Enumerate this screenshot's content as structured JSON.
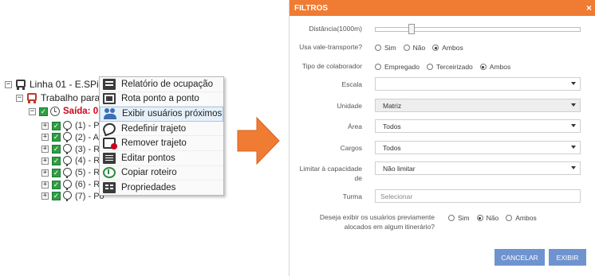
{
  "tree": {
    "line_label": "Linha 01 - E.SPinha",
    "route_label": "Trabalho para c",
    "saida_label": "Saída: 01:",
    "points": [
      "(1) - Po",
      "(2) - Av",
      "(3) - R.",
      "(4) - R.",
      "(5) - R.",
      "(6) - R.",
      "(7) - Po"
    ]
  },
  "context_menu": {
    "items": [
      {
        "label": "Relatório de ocupação",
        "icon": "report-icon"
      },
      {
        "label": "Rota ponto a ponto",
        "icon": "route-icon"
      },
      {
        "label": "Exibir usuários próximos",
        "icon": "users-icon"
      },
      {
        "label": "Redefinir trajeto",
        "icon": "redefine-route-icon"
      },
      {
        "label": "Remover trajeto",
        "icon": "remove-route-icon"
      },
      {
        "label": "Editar pontos",
        "icon": "edit-points-icon"
      },
      {
        "label": "Copiar roteiro",
        "icon": "copy-route-icon"
      },
      {
        "label": "Propriedades",
        "icon": "properties-icon"
      }
    ],
    "active_index": 2
  },
  "modal": {
    "title": "FILTROS",
    "close_symbol": "×",
    "distance_label": "Distância(1000m)",
    "vale_label": "Usa vale-transporte?",
    "vale_options": [
      "Sim",
      "Não",
      "Ambos"
    ],
    "vale_selected": "Ambos",
    "tipo_label": "Tipo de colaborador",
    "tipo_options": [
      "Empregado",
      "Terceirizado",
      "Ambos"
    ],
    "tipo_selected": "Ambos",
    "escala_label": "Escala",
    "escala_value": "",
    "unidade_label": "Unidade",
    "unidade_value": "Matriz",
    "area_label": "Área",
    "area_value": "Todos",
    "cargos_label": "Cargos",
    "cargos_value": "Todos",
    "limitar_label_1": "Limitar à capacidade",
    "limitar_label_2": "de",
    "limitar_value": "Não limitar",
    "turma_label": "Turma",
    "turma_placeholder": "Selecionar",
    "prev_label_1": "Deseja exibir os usuários previamente",
    "prev_label_2": "alocados em algum itinerário?",
    "prev_options": [
      "Sim",
      "Não",
      "Ambos"
    ],
    "prev_selected": "Não",
    "cancel_label": "CANCELAR",
    "submit_label": "EXIBIR"
  },
  "colors": {
    "header": "#f07b32",
    "arrow": "#f07b32",
    "button": "#6f93cf",
    "saida": "#d0021b"
  }
}
